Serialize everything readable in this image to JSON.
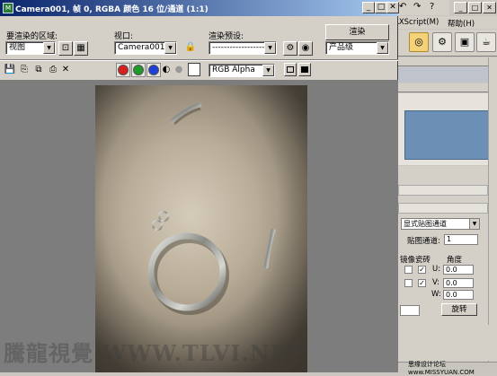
{
  "background_app": {
    "menu": [
      "AXScript(M)",
      "帮助(H)"
    ],
    "combo_value": "显式贴图通道",
    "map_channel_label": "贴图通道:",
    "map_channel_value": "1",
    "mirror_label": "镜像",
    "tile_label": "瓷砖",
    "angle_label": "角度",
    "u_label": "U:",
    "v_label": "V:",
    "w_label": "W:",
    "u_value": "0.0",
    "v_value": "0.0",
    "w_value": "0.0",
    "rotate_button": "旋转",
    "status_text": "思缘设计论坛 www.MISSYUAN.COM"
  },
  "render_window": {
    "title": "Camera001, 帧 0, RGBA 颜色 16 位/通道 (1:1)",
    "area_label": "要渲染的区域:",
    "area_value": "视图",
    "viewport_label": "视口:",
    "viewport_value": "Camera001",
    "preset_label": "渲染预设:",
    "preset_value": "-----------------------",
    "render_button": "渲染",
    "quality_value": "产品级",
    "channel_value": "RGB Alpha",
    "minimize_icon": "minimize-icon",
    "maximize_icon": "maximize-icon",
    "close_icon": "close-icon",
    "colors": {
      "red": "#d61f1f",
      "green": "#1f9a2a",
      "blue": "#1f3fd6"
    }
  },
  "watermark": {
    "text": "騰龍視覺 WWW.TLVI.NET"
  }
}
